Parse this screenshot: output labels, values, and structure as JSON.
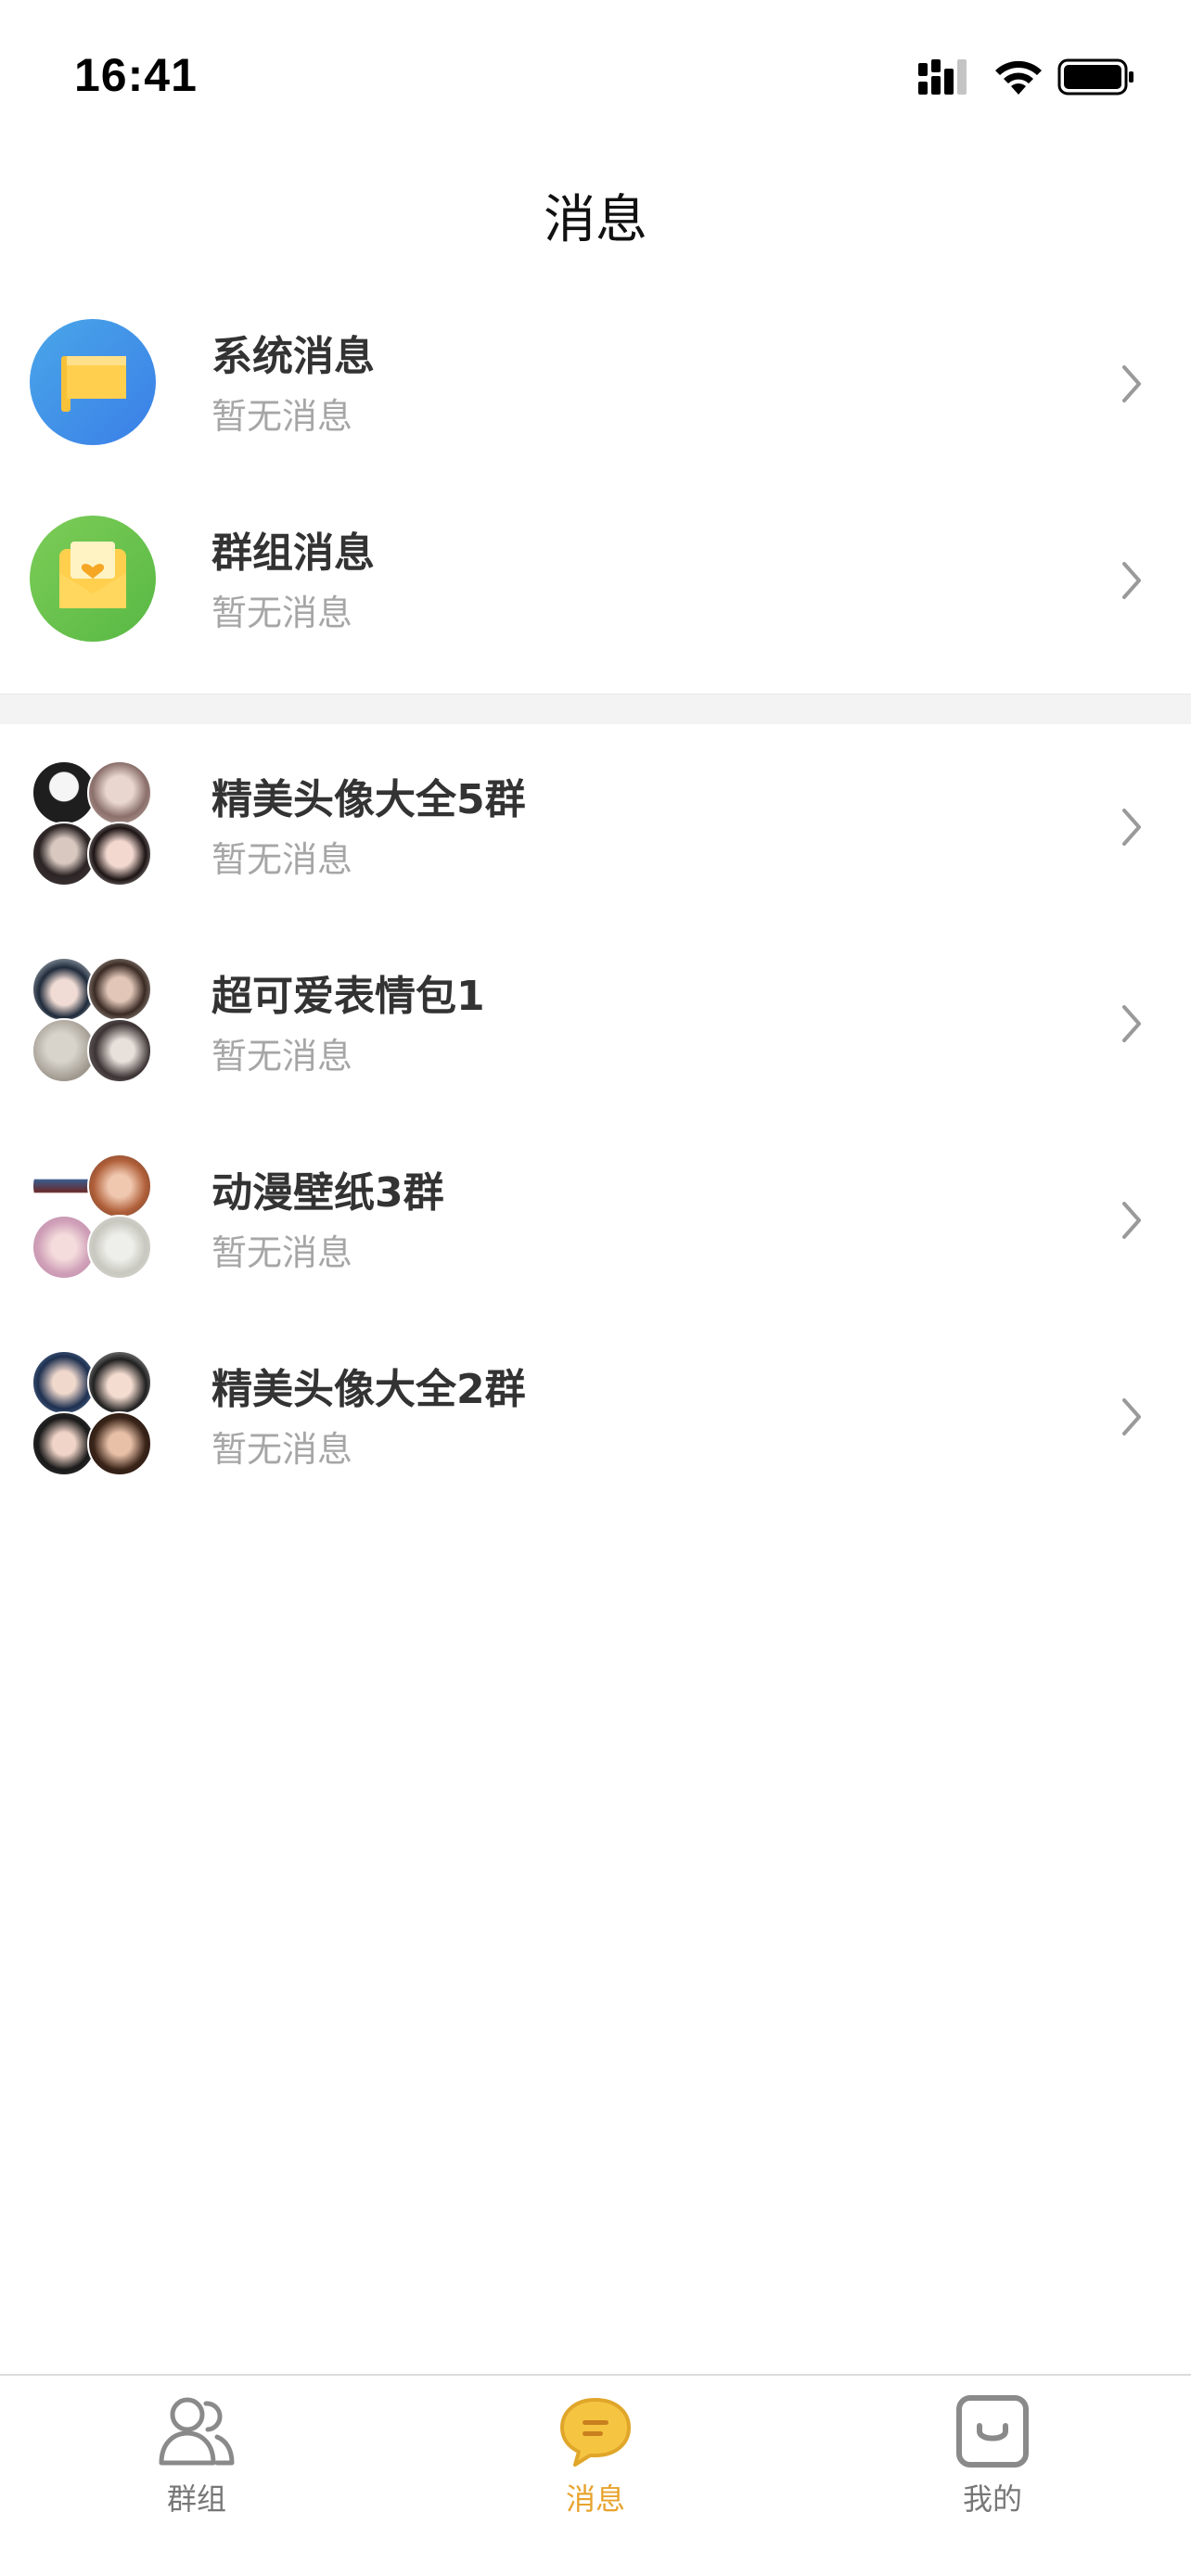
{
  "status_bar": {
    "time": "16:41"
  },
  "header": {
    "title": "消息"
  },
  "system_rows": [
    {
      "title": "系统消息",
      "subtitle": "暂无消息",
      "icon": "flag-icon",
      "color": "#3d8ff0"
    },
    {
      "title": "群组消息",
      "subtitle": "暂无消息",
      "icon": "envelope-heart-icon",
      "color": "#6cc24a"
    }
  ],
  "groups": [
    {
      "title": "精美头像大全5群",
      "subtitle": "暂无消息"
    },
    {
      "title": "超可爱表情包1",
      "subtitle": "暂无消息"
    },
    {
      "title": "动漫壁纸3群",
      "subtitle": "暂无消息"
    },
    {
      "title": "精美头像大全2群",
      "subtitle": "暂无消息"
    }
  ],
  "tab_bar": {
    "active_color": "#e8a32e",
    "tabs": [
      {
        "label": "群组",
        "icon": "users-icon",
        "active": false
      },
      {
        "label": "消息",
        "icon": "chat-bubble-icon",
        "active": true
      },
      {
        "label": "我的",
        "icon": "smile-box-icon",
        "active": false
      }
    ]
  }
}
